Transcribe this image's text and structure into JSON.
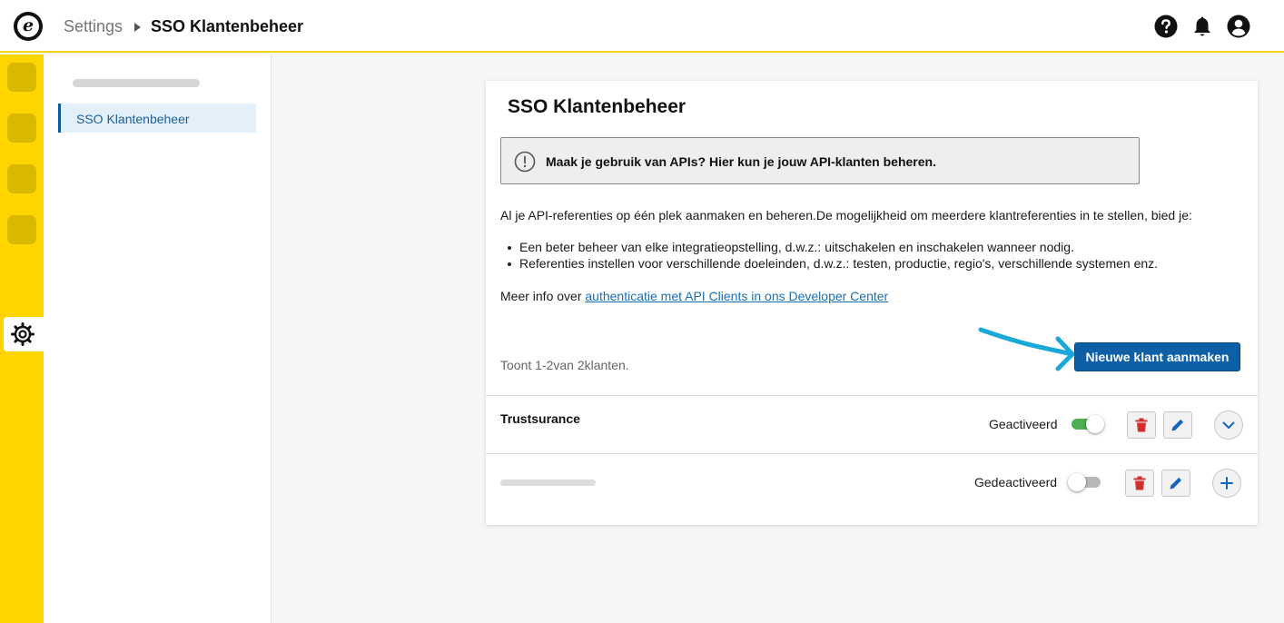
{
  "header": {
    "breadcrumb_root": "Settings",
    "breadcrumb_current": "SSO Klantenbeheer",
    "icons": [
      "help-icon",
      "bell-icon",
      "user-icon"
    ]
  },
  "sidebar": {
    "items": [
      {
        "label": "SSO Klantenbeheer",
        "active": true
      }
    ]
  },
  "main": {
    "title": "SSO Klantenbeheer",
    "alert": "Maak je gebruik van APIs? Hier kun je jouw API-klanten beheren.",
    "intro": "Al je API-referenties op één plek aanmaken en beheren.De mogelijkheid om meerdere klantreferenties in te stellen, bied je:",
    "bullets": [
      "Een beter beheer van elke integratieopstelling, d.w.z.: uitschakelen en inschakelen wanneer nodig.",
      "Referenties instellen voor verschillende doeleinden, d.w.z.: testen, productie, regio's, verschillende systemen enz."
    ],
    "more_info_prefix": "Meer info over",
    "more_info_link": "authenticatie met API Clients in ons Developer Center",
    "count_text": "Toont 1-2van 2klanten.",
    "new_client_button": "Nieuwe klant aanmaken",
    "clients": [
      {
        "name": "Trustsurance",
        "status": "Geactiveerd",
        "active": true
      },
      {
        "name": "",
        "status": "Gedeactiveerd",
        "active": false
      }
    ]
  },
  "colors": {
    "accent_yellow": "#ffd500",
    "primary_blue": "#0d5fa6",
    "toggle_on": "#4caf50",
    "delete_red": "#d32f2f",
    "annotation_arrow": "#1aa8d8"
  }
}
